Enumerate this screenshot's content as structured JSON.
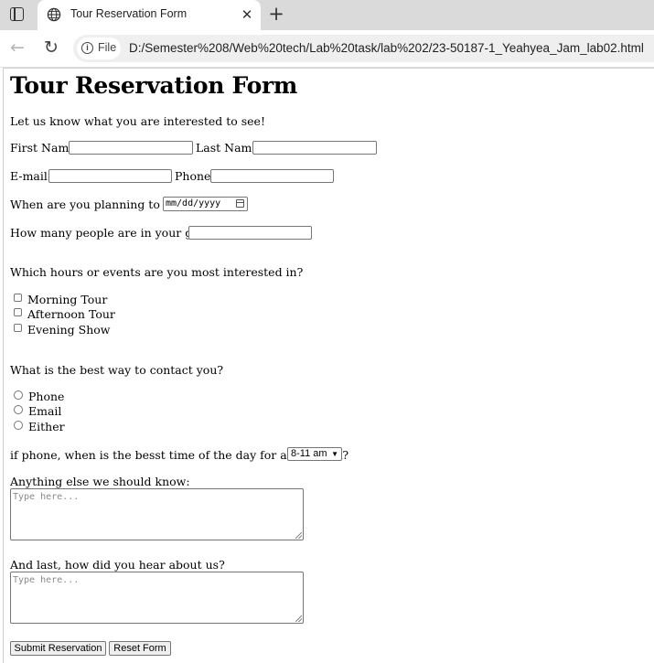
{
  "browser": {
    "tab_title": "Tour Reservation Form",
    "tab_close": "✕",
    "new_tab": "+",
    "chip_label": "File",
    "url": "D:/Semester%208/Web%20tech/Lab%20task/lab%202/23-50187-1_Yeahyea_Jam_lab02.html"
  },
  "form": {
    "title": "Tour Reservation Form",
    "intro": "Let us know what you are interested to see!",
    "first_name_label": "First Name:",
    "last_name_label": "Last Name:",
    "email_label": "E-mail:",
    "phone_label": "Phone:",
    "visit_label": "When are you planning to visit?",
    "date_placeholder": "mm/dd/yyyy",
    "group_label": "How many people are in your group?",
    "events_question": "Which hours or events are you most interested in?",
    "events": [
      "Morning Tour",
      "Afternoon Tour",
      "Evening Show"
    ],
    "contact_question": "What is the best way to contact you?",
    "contact_options": [
      "Phone",
      "Email",
      "Either"
    ],
    "callback_label": "if phone, when is the besst time of the day for a call-back?",
    "callback_selected": "8-11 am",
    "anything_label": "Anything else we should know:",
    "anything_placeholder": "Type here...",
    "heard_label": "And last, how did you hear about us?",
    "heard_placeholder": "Type here...",
    "submit_label": "Submit Reservation",
    "reset_label": "Reset Form"
  }
}
